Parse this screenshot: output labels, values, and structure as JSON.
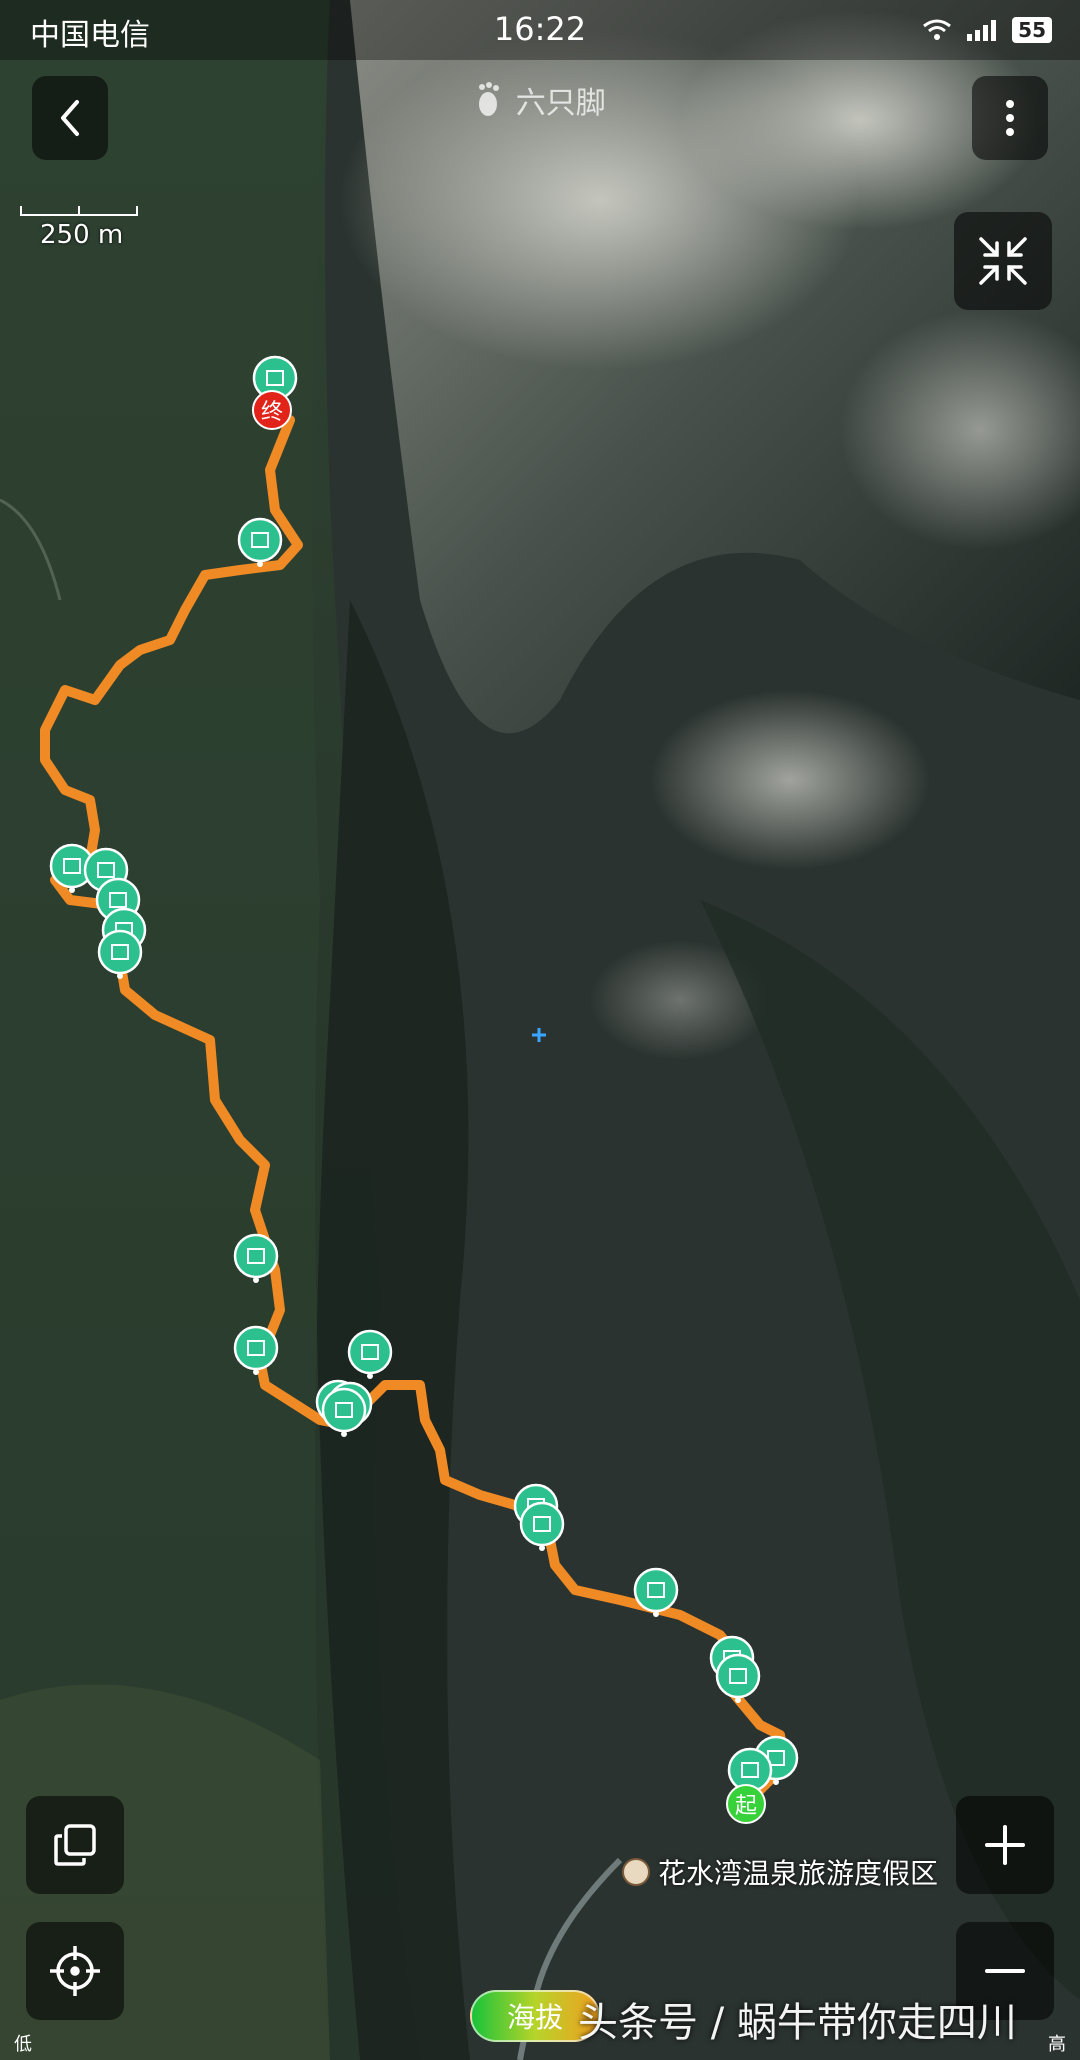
{
  "status_bar": {
    "carrier": "中国电信",
    "time": "16:22",
    "battery": "55"
  },
  "header": {
    "brand": "六只脚",
    "back_icon": "chevron-left-icon",
    "more_icon": "more-vertical-icon"
  },
  "scale": {
    "label": "250 m"
  },
  "map": {
    "type": "satellite",
    "track_color": "#f08a24",
    "photo_marker_color": "#2cc08f",
    "start_label": "起",
    "end_label": "终",
    "poi_label": "花水湾温泉旅游度假区"
  },
  "controls": {
    "collapse_icon": "collapse-icon",
    "copy_icon": "layers-copy-icon",
    "locate_icon": "locate-crosshair-icon",
    "zoom_in_icon": "plus-icon",
    "zoom_out_icon": "minus-icon"
  },
  "elevation_legend": {
    "label": "海拔",
    "low": "低",
    "high": "高"
  },
  "watermark": "头条号 / 蜗牛带你走四川"
}
